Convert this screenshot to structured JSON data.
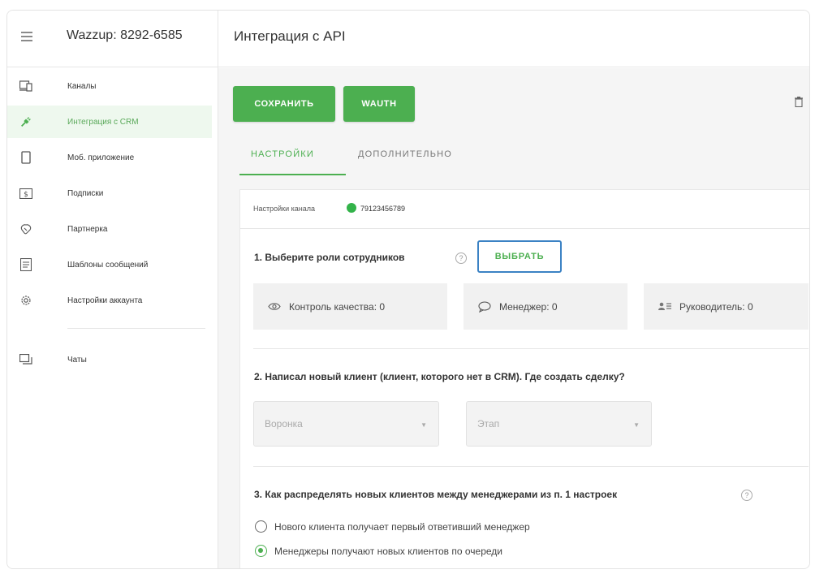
{
  "header": {
    "brand": "Wazzup: 8292-6585",
    "title": "Интеграция с API"
  },
  "sidebar": {
    "items": [
      {
        "label": "Каналы",
        "icon": "channels-icon"
      },
      {
        "label": "Интеграция с CRM",
        "icon": "plug-icon",
        "active": true
      },
      {
        "label": "Моб. приложение",
        "icon": "phone-icon"
      },
      {
        "label": "Подписки",
        "icon": "dollar-icon"
      },
      {
        "label": "Партнерка",
        "icon": "handshake-icon"
      },
      {
        "label": "Шаблоны сообщений",
        "icon": "template-icon"
      },
      {
        "label": "Настройки аккаунта",
        "icon": "gear-icon"
      },
      {
        "label": "Чаты",
        "icon": "chats-icon"
      }
    ]
  },
  "toolbar": {
    "save_label": "СОХРАНИТЬ",
    "wauth_label": "WAUTH"
  },
  "tabs": [
    {
      "label": "НАСТРОЙКИ",
      "active": true
    },
    {
      "label": "ДОПОЛНИТЕЛЬНО",
      "active": false
    }
  ],
  "channel": {
    "label": "Настройки канала",
    "phone": "79123456789"
  },
  "section1": {
    "title": "1. Выберите роли сотрудников",
    "choose_label": "ВЫБРАТЬ",
    "roles": [
      {
        "label": "Контроль качества: 0",
        "icon": "eye-icon"
      },
      {
        "label": "Менеджер: 0",
        "icon": "chat-bubble-icon"
      },
      {
        "label": "Руководитель: 0",
        "icon": "user-list-icon"
      }
    ]
  },
  "section2": {
    "title": "2. Написал новый клиент (клиент, которого нет в CRM). Где создать сделку?",
    "funnel_placeholder": "Воронка",
    "stage_placeholder": "Этап"
  },
  "section3": {
    "title": "3. Как распределять новых клиентов между менеджерами из п. 1 настроек",
    "options": [
      {
        "label": "Нового клиента получает первый ответивший менеджер",
        "checked": false
      },
      {
        "label": "Менеджеры получают новых клиентов по очереди",
        "checked": true
      }
    ]
  },
  "colors": {
    "accent": "#4caf50",
    "focus_border": "#3b82c4",
    "active_nav_bg": "#eef8ee"
  }
}
